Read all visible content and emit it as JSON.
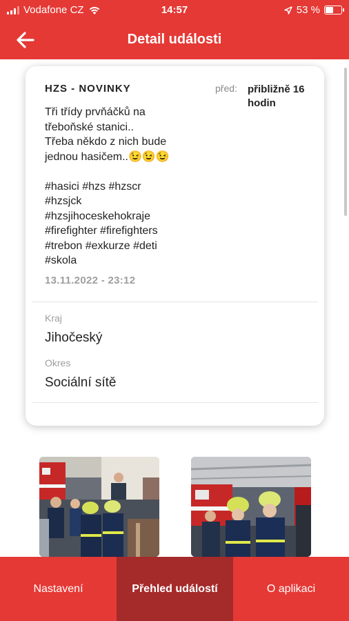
{
  "status_bar": {
    "carrier": "Vodafone CZ",
    "time": "14:57",
    "battery_percent": "53 %",
    "battery_level": 0.53
  },
  "header": {
    "title": "Detail události",
    "back_icon": "arrow-left-icon"
  },
  "event": {
    "source": "HZS - NOVINKY",
    "ago_label": "před:",
    "ago_value": "přibližně 16 hodin",
    "text_lines": [
      "Tři třídy prvňáčků na",
      "třeboňské stanici..",
      "Třeba někdo z nich bude",
      "jednou hasičem..😉😉😉",
      "",
      "#hasici #hzs #hzscr",
      "#hzsjck",
      "#hzsjihoceskehokraje",
      "#firefighter #firefighters",
      "#trebon #exkurze #deti",
      "#skola"
    ],
    "date": "13.11.2022 - 23:12",
    "region_label": "Kraj",
    "region_value": "Jihočeský",
    "district_label": "Okres",
    "district_value": "Sociální sítě"
  },
  "photos": [
    {
      "name": "photo-firefighters-kids-1"
    },
    {
      "name": "photo-firefighters-kids-2"
    }
  ],
  "bottom_nav": {
    "tabs": [
      {
        "label": "Nastavení"
      },
      {
        "label": "Přehled událostí"
      },
      {
        "label": "O aplikaci"
      }
    ],
    "active_index": 1
  },
  "colors": {
    "primary": "#e53935",
    "active_tab": "#a52a2a"
  }
}
